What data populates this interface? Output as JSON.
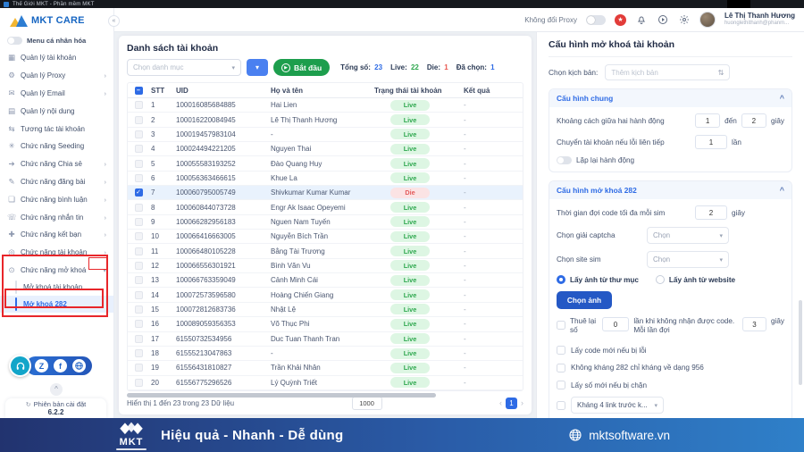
{
  "titlebar": {
    "text": "Thế Giới MKT - Phần mềm MKT"
  },
  "icons": {
    "collapse": "«",
    "caret_down": "▾",
    "chevron_right": "›",
    "chevron_up": "^",
    "check": "✓",
    "minus": "–",
    "prev": "‹",
    "next": "›",
    "up": "^",
    "select_spinner": "⇅",
    "play": "▶",
    "star": "★",
    "version": "↻",
    "zalo": "Z",
    "facebook": "f"
  },
  "colors": {
    "accent": "#2e6be5",
    "green_button": "#1d9e4d",
    "live_text": "#2fa84f",
    "live_bg": "#ddf6e3",
    "die_text": "#e45b5b",
    "die_bg": "#fbe3e4",
    "annotation_red": "#e8262a",
    "footer_gradient_left": "#22336f",
    "footer_gradient_right": "#2f80c9"
  },
  "header": {
    "proxy_label": "Không đổi Proxy",
    "user_name": "Lê Thị Thanh Hương",
    "user_email": "huonglethithanh@phanm..."
  },
  "sidebar": {
    "brand": "MKT CARE",
    "personalize_label": "Menu cá nhân hóa",
    "items": [
      {
        "icon": "accounts-icon",
        "glyph": "▦",
        "label": "Quản lý tài khoản"
      },
      {
        "icon": "proxy-icon",
        "glyph": "⚙",
        "label": "Quản lý Proxy",
        "arrow": "right"
      },
      {
        "icon": "email-icon",
        "glyph": "✉",
        "label": "Quản lý Email",
        "arrow": "right"
      },
      {
        "icon": "content-icon",
        "glyph": "▤",
        "label": "Quản lý nội dung"
      },
      {
        "icon": "interaction-icon",
        "glyph": "⇆",
        "label": "Tương tác tài khoản"
      },
      {
        "icon": "seeding-icon",
        "glyph": "✳",
        "label": "Chức năng Seeding"
      },
      {
        "icon": "share-icon",
        "glyph": "➔",
        "label": "Chức năng Chia sẻ",
        "arrow": "right"
      },
      {
        "icon": "post-icon",
        "glyph": "✎",
        "label": "Chức năng đăng bài",
        "arrow": "right"
      },
      {
        "icon": "comment-icon",
        "glyph": "❏",
        "label": "Chức năng bình luận",
        "arrow": "right"
      },
      {
        "icon": "message-icon",
        "glyph": "☏",
        "label": "Chức năng nhắn tin",
        "arrow": "right"
      },
      {
        "icon": "friend-icon",
        "glyph": "✚",
        "label": "Chức năng kết bạn",
        "arrow": "right"
      },
      {
        "icon": "account-feature-icon",
        "glyph": "◎",
        "label": "Chức năng tài khoản",
        "arrow": "right"
      },
      {
        "icon": "unlock-icon",
        "glyph": "⊙",
        "label": "Chức năng mở khoá",
        "arrow": "down"
      },
      {
        "sub": true,
        "label": "Mở khoá tài khoản"
      },
      {
        "sub": true,
        "label": "Mở khoá 282",
        "active": true
      }
    ],
    "version_label": "Phiên bản cài đặt",
    "version": "6.2.2"
  },
  "main": {
    "title": "Danh sách tài khoản",
    "category_placeholder": "Chọn danh mục",
    "start_button": "Bắt đầu",
    "stats": [
      {
        "label": "Tổng số:",
        "value": "23",
        "color": "#2e6be5"
      },
      {
        "label": "Live:",
        "value": "22",
        "color": "#2fa84f"
      },
      {
        "label": "Die:",
        "value": "1",
        "color": "#e8574f"
      },
      {
        "label": "Đã chọn:",
        "value": "1",
        "color": "#2e6be5"
      }
    ],
    "table": {
      "headers": {
        "stt": "STT",
        "uid": "UID",
        "name": "Họ và tên",
        "status": "Trạng thái tài khoản",
        "result": "Kết quả"
      },
      "rows": [
        {
          "stt": "1",
          "uid": "100016085684885",
          "name": "Hai Lien",
          "status": "Live",
          "result": "-"
        },
        {
          "stt": "2",
          "uid": "100016220084945",
          "name": "Lê Thị Thanh Hương",
          "status": "Live",
          "result": "-"
        },
        {
          "stt": "3",
          "uid": "100019457983104",
          "name": "-",
          "status": "Live",
          "result": "-"
        },
        {
          "stt": "4",
          "uid": "100024494221205",
          "name": "Nguyen Thai",
          "status": "Live",
          "result": "-"
        },
        {
          "stt": "5",
          "uid": "100055583193252",
          "name": "Đào Quang Huy",
          "status": "Live",
          "result": "-"
        },
        {
          "stt": "6",
          "uid": "100056363466615",
          "name": "Khue La",
          "status": "Live",
          "result": "-"
        },
        {
          "stt": "7",
          "uid": "100060795005749",
          "name": "Shivkumar Kumar Kumar",
          "status": "Die",
          "result": "-",
          "checked": true
        },
        {
          "stt": "8",
          "uid": "100060844073728",
          "name": "Engr Ak Isaac Opeyemi",
          "status": "Live",
          "result": "-"
        },
        {
          "stt": "9",
          "uid": "100066282956183",
          "name": "Nguen Nam Tuyến",
          "status": "Live",
          "result": "-"
        },
        {
          "stt": "10",
          "uid": "100066416663005",
          "name": "Nguyễn Bích Trần",
          "status": "Live",
          "result": "-"
        },
        {
          "stt": "11",
          "uid": "100066480105228",
          "name": "Bằng Tài Trương",
          "status": "Live",
          "result": "-"
        },
        {
          "stt": "12",
          "uid": "100066556301921",
          "name": "Bình Văn Vu",
          "status": "Live",
          "result": "-"
        },
        {
          "stt": "13",
          "uid": "100066763359049",
          "name": "Cảnh Minh Cái",
          "status": "Live",
          "result": "-"
        },
        {
          "stt": "14",
          "uid": "100072573596580",
          "name": "Hoàng Chiến Giang",
          "status": "Live",
          "result": "-"
        },
        {
          "stt": "15",
          "uid": "100072812683736",
          "name": "Nhật Lệ",
          "status": "Live",
          "result": "-"
        },
        {
          "stt": "16",
          "uid": "100089059356353",
          "name": "Võ Thục Phi",
          "status": "Live",
          "result": "-"
        },
        {
          "stt": "17",
          "uid": "61550732534956",
          "name": "Duc Tuan Thanh Tran",
          "status": "Live",
          "result": "-"
        },
        {
          "stt": "18",
          "uid": "61555213047863",
          "name": "-",
          "status": "Live",
          "result": "-"
        },
        {
          "stt": "19",
          "uid": "61556431810827",
          "name": "Trần Khải Nhân",
          "status": "Live",
          "result": "-"
        },
        {
          "stt": "20",
          "uid": "61556775296526",
          "name": "Lý Quỳnh Triết",
          "status": "Live",
          "result": "-"
        }
      ]
    },
    "pagination": {
      "info": "Hiển thị 1 đến 23 trong 23 Dữ liệu",
      "page_size": "1000",
      "page": "1"
    }
  },
  "panel": {
    "title": "Cấu hình mở khoá tài khoản",
    "scenario_label": "Chọn kịch bản:",
    "scenario_placeholder": "Thêm kịch bản",
    "general": {
      "title": "Cấu hình chung",
      "gap_label": "Khoảng cách giữa hai hành động",
      "gap_from": "1",
      "gap_to_word": "đến",
      "gap_to": "2",
      "gap_unit": "giây",
      "switch_label": "Chuyển tài khoản nếu lỗi liên tiếp",
      "switch_value": "1",
      "switch_unit": "lần",
      "repeat_label": "Lặp lại hành động"
    },
    "unlock": {
      "title": "Cấu hình mở khoá 282",
      "wait_label": "Thời gian đợi code tối đa mỗi sim",
      "wait_value": "2",
      "wait_unit": "giây",
      "captcha_label": "Chọn giải captcha",
      "captcha_placeholder": "Chọn",
      "sim_label": "Chọn site sim",
      "sim_placeholder": "Chọn",
      "radio_folder": "Lấy ảnh từ thư mục",
      "radio_website": "Lấy ảnh từ website",
      "choose_image_button": "Chọn ảnh",
      "rehire_prefix": "Thuê lại số",
      "rehire_count": "0",
      "rehire_middle": "lần khi không nhận được code. Mỗi lần đợi",
      "rehire_wait": "3",
      "rehire_unit": "giây",
      "checkboxes": [
        "Lấy code mới nếu bị lỗi",
        "Không kháng 282 chỉ kháng về dạng 956",
        "Lấy số mới nếu bị chặn"
      ],
      "khang_select": "Kháng 4 link trước k..."
    }
  },
  "footer": {
    "logo_text": "MKT",
    "slogan": "Hiệu quả - Nhanh - Dễ dùng",
    "website": "mktsoftware.vn"
  }
}
